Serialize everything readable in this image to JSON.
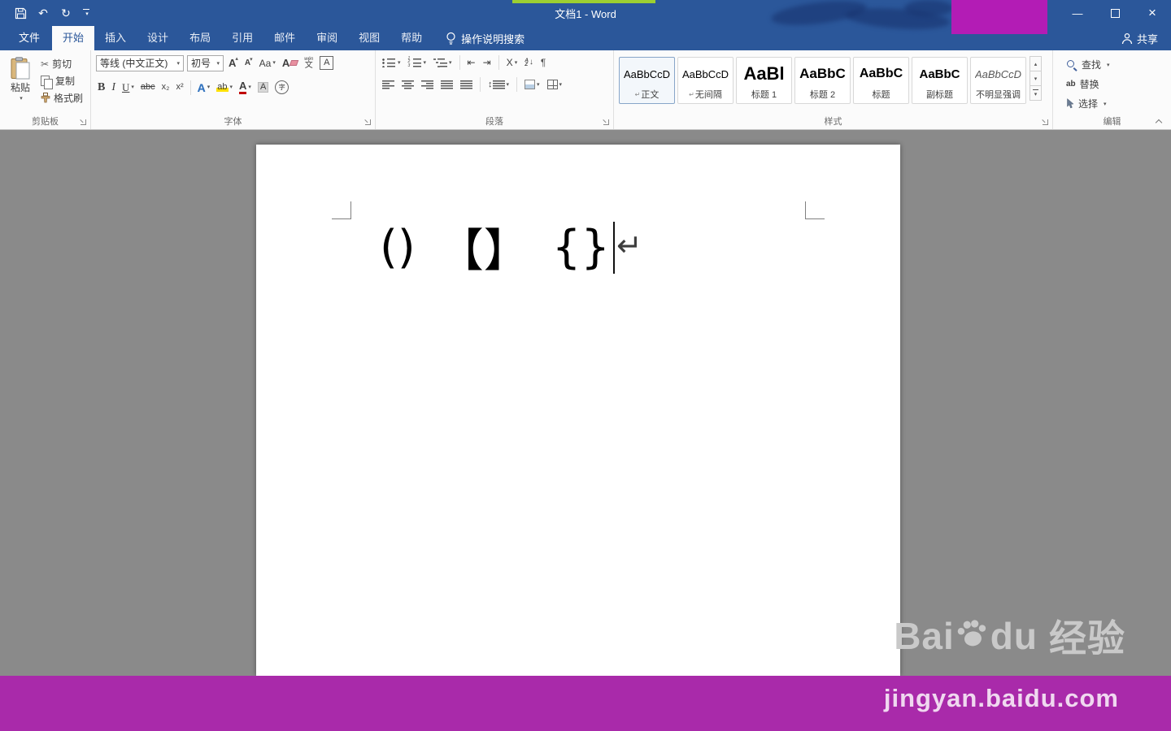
{
  "titlebar": {
    "title": "文档1 - Word"
  },
  "tabs": {
    "file": "文件",
    "items": [
      "开始",
      "插入",
      "设计",
      "布局",
      "引用",
      "邮件",
      "审阅",
      "视图",
      "帮助"
    ],
    "tellme": "操作说明搜索",
    "share": "共享"
  },
  "ribbon": {
    "clipboard": {
      "label": "剪贴板",
      "paste": "粘贴",
      "cut": "剪切",
      "copy": "复制",
      "format_painter": "格式刷"
    },
    "font": {
      "label": "字体",
      "name": "等线 (中文正文)",
      "size": "初号"
    },
    "paragraph": {
      "label": "段落"
    },
    "styles": {
      "label": "样式",
      "items": [
        {
          "sample": "AaBbCcD",
          "name": "正文"
        },
        {
          "sample": "AaBbCcD",
          "name": "无间隔"
        },
        {
          "sample": "AaBl",
          "name": "标题 1"
        },
        {
          "sample": "AaBbC",
          "name": "标题 2"
        },
        {
          "sample": "AaBbC",
          "name": "标题"
        },
        {
          "sample": "AaBbC",
          "name": "副标题"
        },
        {
          "sample": "AaBbCcD",
          "name": "不明显强调"
        }
      ]
    },
    "editing": {
      "label": "编辑",
      "find": "查找",
      "replace": "替换",
      "select": "选择"
    }
  },
  "document": {
    "parens": "()",
    "square_brackets": "【】",
    "braces": "{}"
  },
  "watermark": {
    "bai": "Bai",
    "du": "du",
    "suffix": "经验",
    "url": "jingyan.baidu.com"
  },
  "icons": {
    "dropdown": "▾",
    "caret_up": "▴",
    "undo": "↶",
    "redo": "↻",
    "minimize": "—",
    "close": "×",
    "cut_scissors": "✂",
    "bold": "B",
    "italic": "I",
    "underline": "U",
    "strikethrough": "abc",
    "subscript": "x₂",
    "superscript": "x²",
    "letter_a": "A",
    "change_case": "Aa",
    "pinyin_top": "wén",
    "pinyin_bottom": "文",
    "enclose_char": "字",
    "highlight_ab": "ab",
    "replace_ab": "ab",
    "letter_x": "X",
    "letter_z": "Z",
    "arrow_down": "↓",
    "dedent": "⇤",
    "indent": "⇥",
    "pilcrow": "¶",
    "updown": "↕",
    "enter_mark": "↵",
    "scroll_up": "▴",
    "scroll_down": "▾"
  },
  "colors": {
    "titlebar_blue": "#2b579a",
    "ribbon_bg": "#fbfbfb",
    "canvas_gray": "#8a8a8a",
    "bottom_bar_purple": "#a92aaa",
    "censor_purple": "#b31cb5",
    "font_color_red": "#c00000",
    "highlight_yellow": "#ffe100"
  }
}
